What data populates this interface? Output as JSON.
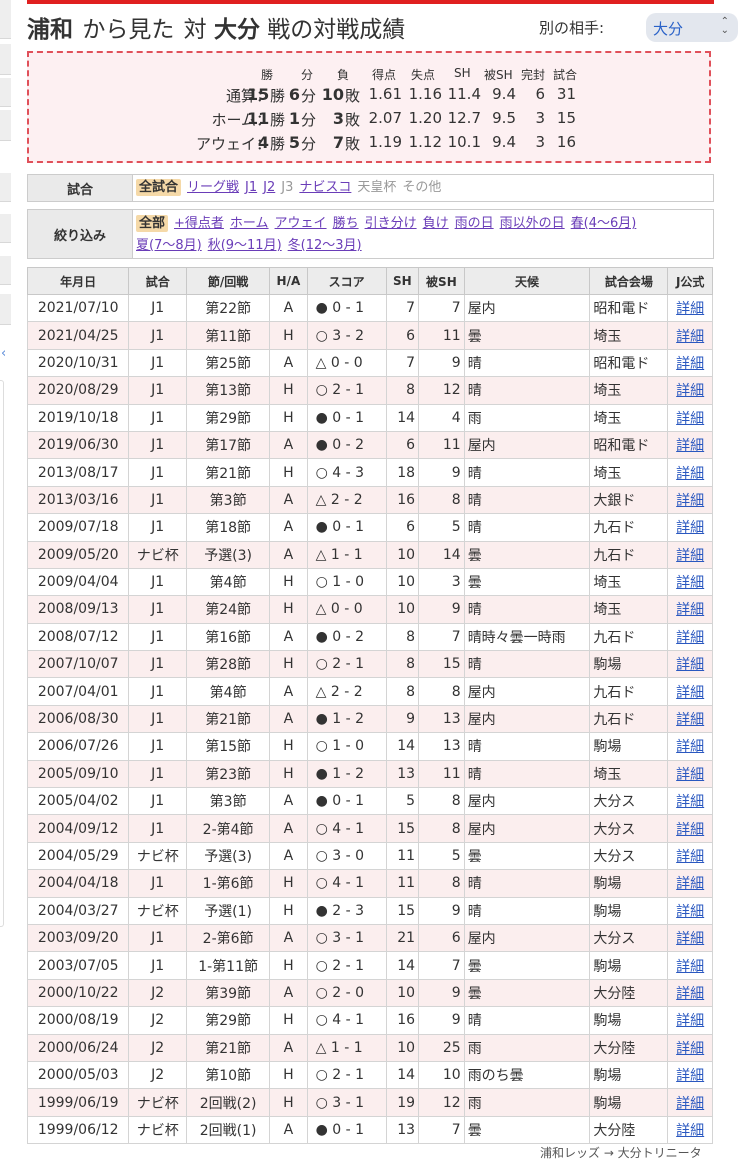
{
  "page": {
    "title_home": "浦和",
    "title_mid1": "から見た",
    "title_mid2": "対",
    "title_opp": "大分",
    "title_suffix": "戦の対戦成績",
    "opponent_label": "別の相手:",
    "opponent_selected": "大分"
  },
  "summary": {
    "headers": [
      "勝",
      "分",
      "負",
      "得点",
      "失点",
      "SH",
      "被SH",
      "完封",
      "試合"
    ],
    "rows": [
      {
        "label": "通算：",
        "win": "15",
        "win_u": "勝",
        "draw": "6",
        "draw_u": "分",
        "loss": "10",
        "loss_u": "敗",
        "gf": "1.61",
        "ga": "1.16",
        "sh": "11.4",
        "opp_sh": "9.4",
        "clean": "6",
        "games": "31"
      },
      {
        "label": "ホーム：",
        "win": "11",
        "win_u": "勝",
        "draw": "1",
        "draw_u": "分",
        "loss": "3",
        "loss_u": "敗",
        "gf": "2.07",
        "ga": "1.20",
        "sh": "12.7",
        "opp_sh": "9.5",
        "clean": "3",
        "games": "15"
      },
      {
        "label": "アウェイ：",
        "win": "4",
        "win_u": "勝",
        "draw": "5",
        "draw_u": "分",
        "loss": "7",
        "loss_u": "敗",
        "gf": "1.19",
        "ga": "1.12",
        "sh": "10.1",
        "opp_sh": "9.4",
        "clean": "3",
        "games": "16"
      }
    ]
  },
  "filters": {
    "match_label": "試合",
    "match_options": [
      {
        "text": "全試合",
        "state": "selected"
      },
      {
        "text": "リーグ戦",
        "state": "link"
      },
      {
        "text": "J1",
        "state": "link"
      },
      {
        "text": "J2",
        "state": "link"
      },
      {
        "text": "J3",
        "state": "disabled"
      },
      {
        "text": "ナビスコ",
        "state": "link"
      },
      {
        "text": "天皇杯",
        "state": "disabled"
      },
      {
        "text": "その他",
        "state": "disabled"
      }
    ],
    "narrow_label": "絞り込み",
    "narrow_options": [
      {
        "text": "全部",
        "state": "selected"
      },
      {
        "text": "+得点者",
        "state": "link"
      },
      {
        "text": "ホーム",
        "state": "link"
      },
      {
        "text": "アウェイ",
        "state": "link"
      },
      {
        "text": "勝ち",
        "state": "link"
      },
      {
        "text": "引き分け",
        "state": "link"
      },
      {
        "text": "負け",
        "state": "link"
      },
      {
        "text": "雨の日",
        "state": "link"
      },
      {
        "text": "雨以外の日",
        "state": "link"
      },
      {
        "text": "春(4〜6月)",
        "state": "link"
      },
      {
        "text": "夏(7〜8月)",
        "state": "link"
      },
      {
        "text": "秋(9〜11月)",
        "state": "link"
      },
      {
        "text": "冬(12〜3月)",
        "state": "link"
      }
    ]
  },
  "table": {
    "headers": [
      "年月日",
      "試合",
      "節/回戦",
      "H/A",
      "スコア",
      "SH",
      "被SH",
      "天候",
      "試合会場",
      "J公式"
    ],
    "rows": [
      [
        "2021/07/10",
        "J1",
        "第22節",
        "A",
        "● 0 - 1",
        "7",
        "7",
        "屋内",
        "昭和電ド",
        "詳細"
      ],
      [
        "2021/04/25",
        "J1",
        "第11節",
        "H",
        "○ 3 - 2",
        "6",
        "11",
        "曇",
        "埼玉",
        "詳細"
      ],
      [
        "2020/10/31",
        "J1",
        "第25節",
        "A",
        "△ 0 - 0",
        "7",
        "9",
        "晴",
        "昭和電ド",
        "詳細"
      ],
      [
        "2020/08/29",
        "J1",
        "第13節",
        "H",
        "○ 2 - 1",
        "8",
        "12",
        "晴",
        "埼玉",
        "詳細"
      ],
      [
        "2019/10/18",
        "J1",
        "第29節",
        "H",
        "● 0 - 1",
        "14",
        "4",
        "雨",
        "埼玉",
        "詳細"
      ],
      [
        "2019/06/30",
        "J1",
        "第17節",
        "A",
        "● 0 - 2",
        "6",
        "11",
        "屋内",
        "昭和電ド",
        "詳細"
      ],
      [
        "2013/08/17",
        "J1",
        "第21節",
        "H",
        "○ 4 - 3",
        "18",
        "9",
        "晴",
        "埼玉",
        "詳細"
      ],
      [
        "2013/03/16",
        "J1",
        "第3節",
        "A",
        "△ 2 - 2",
        "16",
        "8",
        "晴",
        "大銀ド",
        "詳細"
      ],
      [
        "2009/07/18",
        "J1",
        "第18節",
        "A",
        "● 0 - 1",
        "6",
        "5",
        "晴",
        "九石ド",
        "詳細"
      ],
      [
        "2009/05/20",
        "ナビ杯",
        "予選(3)",
        "A",
        "△ 1 - 1",
        "10",
        "14",
        "曇",
        "九石ド",
        "詳細"
      ],
      [
        "2009/04/04",
        "J1",
        "第4節",
        "H",
        "○ 1 - 0",
        "10",
        "3",
        "曇",
        "埼玉",
        "詳細"
      ],
      [
        "2008/09/13",
        "J1",
        "第24節",
        "H",
        "△ 0 - 0",
        "10",
        "9",
        "晴",
        "埼玉",
        "詳細"
      ],
      [
        "2008/07/12",
        "J1",
        "第16節",
        "A",
        "● 0 - 2",
        "8",
        "7",
        "晴時々曇一時雨",
        "九石ド",
        "詳細"
      ],
      [
        "2007/10/07",
        "J1",
        "第28節",
        "H",
        "○ 2 - 1",
        "8",
        "15",
        "晴",
        "駒場",
        "詳細"
      ],
      [
        "2007/04/01",
        "J1",
        "第4節",
        "A",
        "△ 2 - 2",
        "8",
        "8",
        "屋内",
        "九石ド",
        "詳細"
      ],
      [
        "2006/08/30",
        "J1",
        "第21節",
        "A",
        "● 1 - 2",
        "9",
        "13",
        "屋内",
        "九石ド",
        "詳細"
      ],
      [
        "2006/07/26",
        "J1",
        "第15節",
        "H",
        "○ 1 - 0",
        "14",
        "13",
        "晴",
        "駒場",
        "詳細"
      ],
      [
        "2005/09/10",
        "J1",
        "第23節",
        "H",
        "● 1 - 2",
        "13",
        "11",
        "晴",
        "埼玉",
        "詳細"
      ],
      [
        "2005/04/02",
        "J1",
        "第3節",
        "A",
        "● 0 - 1",
        "5",
        "8",
        "屋内",
        "大分ス",
        "詳細"
      ],
      [
        "2004/09/12",
        "J1",
        "2-第4節",
        "A",
        "○ 4 - 1",
        "15",
        "8",
        "屋内",
        "大分ス",
        "詳細"
      ],
      [
        "2004/05/29",
        "ナビ杯",
        "予選(3)",
        "A",
        "○ 3 - 0",
        "11",
        "5",
        "曇",
        "大分ス",
        "詳細"
      ],
      [
        "2004/04/18",
        "J1",
        "1-第6節",
        "H",
        "○ 4 - 1",
        "11",
        "8",
        "晴",
        "駒場",
        "詳細"
      ],
      [
        "2004/03/27",
        "ナビ杯",
        "予選(1)",
        "H",
        "● 2 - 3",
        "15",
        "9",
        "晴",
        "駒場",
        "詳細"
      ],
      [
        "2003/09/20",
        "J1",
        "2-第6節",
        "A",
        "○ 3 - 1",
        "21",
        "6",
        "屋内",
        "大分ス",
        "詳細"
      ],
      [
        "2003/07/05",
        "J1",
        "1-第11節",
        "H",
        "○ 2 - 1",
        "14",
        "7",
        "曇",
        "駒場",
        "詳細"
      ],
      [
        "2000/10/22",
        "J2",
        "第39節",
        "A",
        "○ 2 - 0",
        "10",
        "9",
        "曇",
        "大分陸",
        "詳細"
      ],
      [
        "2000/08/19",
        "J2",
        "第29節",
        "H",
        "○ 4 - 1",
        "16",
        "9",
        "晴",
        "駒場",
        "詳細"
      ],
      [
        "2000/06/24",
        "J2",
        "第21節",
        "A",
        "△ 1 - 1",
        "10",
        "25",
        "雨",
        "大分陸",
        "詳細"
      ],
      [
        "2000/05/03",
        "J2",
        "第10節",
        "H",
        "○ 2 - 1",
        "14",
        "10",
        "雨のち曇",
        "駒場",
        "詳細"
      ],
      [
        "1999/06/19",
        "ナビ杯",
        "2回戦(2)",
        "H",
        "○ 3 - 1",
        "19",
        "12",
        "雨",
        "駒場",
        "詳細"
      ],
      [
        "1999/06/12",
        "ナビ杯",
        "2回戦(1)",
        "A",
        "● 0 - 1",
        "13",
        "7",
        "曇",
        "大分陸",
        "詳細"
      ]
    ]
  },
  "footer": {
    "text": "浦和レッズ → 大分トリニータ"
  }
}
